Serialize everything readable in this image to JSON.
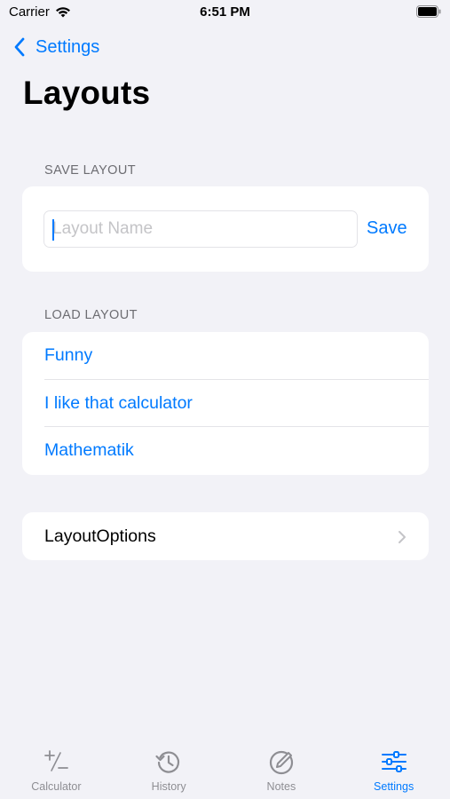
{
  "status_bar": {
    "carrier": "Carrier",
    "time": "6:51 PM"
  },
  "nav": {
    "back_label": "Settings",
    "title": "Layouts"
  },
  "save_section": {
    "header": "SAVE LAYOUT",
    "input_placeholder": "Layout Name",
    "input_value": "",
    "save_label": "Save"
  },
  "load_section": {
    "header": "LOAD LAYOUT",
    "items": [
      {
        "label": "Funny"
      },
      {
        "label": "I like that calculator"
      },
      {
        "label": "Mathematik"
      }
    ]
  },
  "options_row": {
    "label": "LayoutOptions"
  },
  "tab_bar": {
    "tabs": [
      {
        "label": "Calculator",
        "icon": "plus-minus-icon",
        "active": false
      },
      {
        "label": "History",
        "icon": "history-icon",
        "active": false
      },
      {
        "label": "Notes",
        "icon": "notes-icon",
        "active": false
      },
      {
        "label": "Settings",
        "icon": "sliders-icon",
        "active": true
      }
    ]
  },
  "colors": {
    "accent": "#007aff",
    "background": "#f2f2f7",
    "inactive_tab": "#8e8e93"
  }
}
